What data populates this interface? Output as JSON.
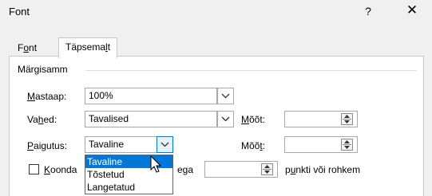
{
  "window": {
    "title": "Font",
    "help_label": "?",
    "close_label": "✕"
  },
  "tabs": [
    {
      "label_pre": "F",
      "label_u": "o",
      "label_post": "nt",
      "selected": false
    },
    {
      "label_pre": "Täpsema",
      "label_u": "l",
      "label_post": "t",
      "selected": true
    }
  ],
  "group": {
    "title": "Märgisamm"
  },
  "scale": {
    "label_u": "M",
    "label_post": "astaap:",
    "value": "100%"
  },
  "spacing": {
    "label_pre": "Va",
    "label_u": "h",
    "label_post": "ed:",
    "value": "Tavalised",
    "by_label_u": "M",
    "by_label_post": "õõt:",
    "by_value": ""
  },
  "position": {
    "label_u": "P",
    "label_post": "aigutus:",
    "value": "Tavaline",
    "by_label_pre": "Mõõ",
    "by_label_u": "t",
    "by_label_post": ":",
    "by_value": "",
    "options": [
      "Tavaline",
      "Tõstetud",
      "Langetatud"
    ],
    "selected_index": 0
  },
  "kerning": {
    "label_u": "K",
    "label_post": "oonda",
    "label_tail": "ega",
    "value": "",
    "suffix_pre": "p",
    "suffix_u": "u",
    "suffix_post": "nkti või rohkem",
    "checked": false
  },
  "icons": {
    "dropdown": "chevron-down-icon",
    "spin_up": "spin-up-icon",
    "spin_down": "spin-down-icon",
    "pointer": "mouse-pointer-icon"
  },
  "colors": {
    "selection": "#0078d7"
  }
}
